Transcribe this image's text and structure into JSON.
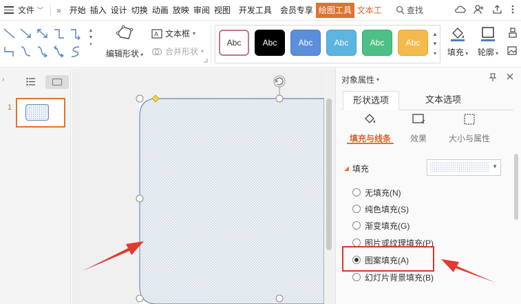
{
  "menubar": {
    "file_label": "文件",
    "more_label": "»",
    "tabs": [
      "开始",
      "插入",
      "设计",
      "切换",
      "动画",
      "放映",
      "审阅",
      "视图",
      "开发工具",
      "会员专享",
      "绘图工具",
      "文本工"
    ],
    "active_tab_index": 10,
    "search_label": "查找"
  },
  "ribbon": {
    "edit_shape_label": "编辑形状",
    "textbox_label": "文本框",
    "merge_shape_label": "合并形状",
    "styles": [
      {
        "label": "Abc",
        "bg": "#ffffff",
        "fg": "#333333",
        "border": "#c0768a"
      },
      {
        "label": "Abc",
        "bg": "#000000",
        "fg": "#ffffff",
        "border": "#000000"
      },
      {
        "label": "Abc",
        "bg": "#5b8fdb",
        "fg": "#ffffff",
        "border": "#4a7cc6"
      },
      {
        "label": "Abc",
        "bg": "#5cb4e0",
        "fg": "#ffffff",
        "border": "#4aa0cc"
      },
      {
        "label": "Abc",
        "bg": "#4cc087",
        "fg": "#ffffff",
        "border": "#3aa872"
      },
      {
        "label": "Abc",
        "bg": "#f6b94d",
        "fg": "#ffffff",
        "border": "#e3a339"
      }
    ],
    "fill_label": "填充",
    "outline_label": "轮廓"
  },
  "thumbnails": {
    "slides": [
      {
        "number": "1"
      }
    ]
  },
  "properties": {
    "title": "对象属性",
    "tabs": [
      "形状选项",
      "文本选项"
    ],
    "subtabs": [
      "填充与线条",
      "效果",
      "大小与属性"
    ],
    "section_title": "填充",
    "fill_options": [
      "无填充(N)",
      "纯色填充(S)",
      "渐变填充(G)",
      "图片或纹理填充(P)",
      "图案填充(A)",
      "幻灯片背景填充(B)"
    ],
    "selected_fill_index": 4
  },
  "colors": {
    "accent": "#e0722f",
    "annotation": "#d9342b",
    "shape_outline": "#6a8ab0"
  }
}
